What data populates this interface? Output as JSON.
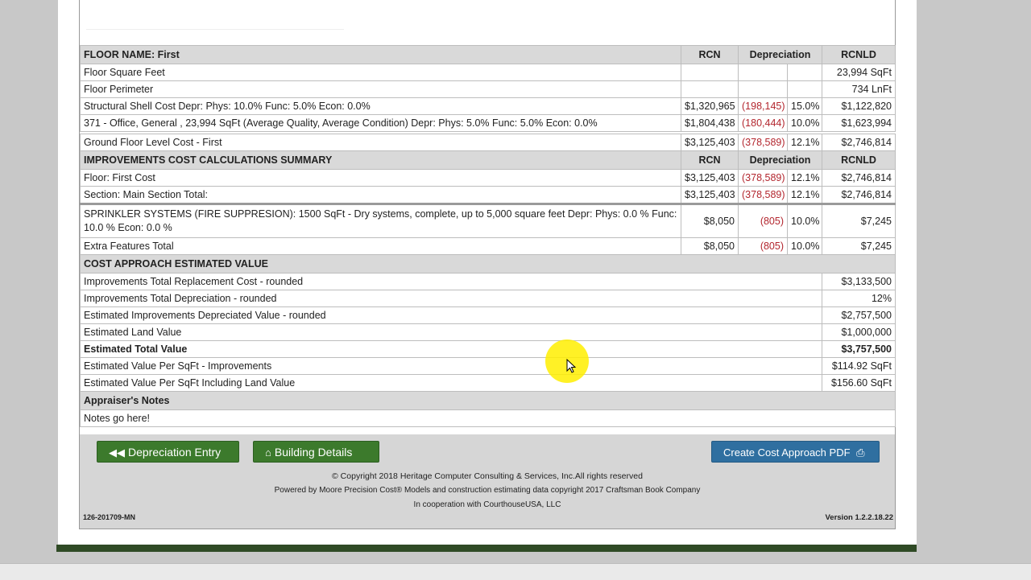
{
  "floor_section": {
    "header": {
      "label": "FLOOR NAME: First",
      "rcn": "RCN",
      "depreciation": "Depreciation",
      "rcnld": "RCNLD"
    },
    "rows": [
      {
        "label": "Floor Square Feet",
        "rcn": "",
        "dep": "",
        "pct": "",
        "rcnld": "23,994 SqFt"
      },
      {
        "label": "Floor Perimeter",
        "rcn": "",
        "dep": "",
        "pct": "",
        "rcnld": "734 LnFt"
      },
      {
        "label": "Structural Shell Cost Depr: Phys: 10.0% Func: 5.0% Econ: 0.0%",
        "rcn": "$1,320,965",
        "dep": "(198,145)",
        "pct": "15.0%",
        "rcnld": "$1,122,820"
      },
      {
        "label": "371 - Office, General , 23,994 SqFt (Average Quality, Average Condition) Depr: Phys: 5.0% Func: 5.0% Econ: 0.0%",
        "rcn": "$1,804,438",
        "dep": "(180,444)",
        "pct": "10.0%",
        "rcnld": "$1,623,994"
      }
    ],
    "ground": {
      "label": "Ground Floor Level Cost - First",
      "rcn": "$3,125,403",
      "dep": "(378,589)",
      "pct": "12.1%",
      "rcnld": "$2,746,814"
    }
  },
  "summary_section": {
    "header": {
      "label": "IMPROVEMENTS COST CALCULATIONS SUMMARY",
      "rcn": "RCN",
      "depreciation": "Depreciation",
      "rcnld": "RCNLD"
    },
    "rows": [
      {
        "label": "Floor: First Cost",
        "rcn": "$3,125,403",
        "dep": "(378,589)",
        "pct": "12.1%",
        "rcnld": "$2,746,814"
      },
      {
        "label": "Section: Main Section Total:",
        "rcn": "$3,125,403",
        "dep": "(378,589)",
        "pct": "12.1%",
        "rcnld": "$2,746,814"
      }
    ],
    "sprinkler": {
      "label": "SPRINKLER SYSTEMS (FIRE SUPPRESION): 1500 SqFt - Dry systems, complete, up to 5,000 square feet Depr: Phys: 0.0 % Func: 10.0 % Econ: 0.0 %",
      "rcn": "$8,050",
      "dep": "(805)",
      "pct": "10.0%",
      "rcnld": "$7,245"
    },
    "extra": {
      "label": "Extra Features Total",
      "rcn": "$8,050",
      "dep": "(805)",
      "pct": "10.0%",
      "rcnld": "$7,245"
    }
  },
  "cost_approach": {
    "header": "COST APPROACH ESTIMATED VALUE",
    "rows": [
      {
        "label": "Improvements Total Replacement Cost - rounded",
        "value": "$3,133,500"
      },
      {
        "label": "Improvements Total Depreciation - rounded",
        "value": "12%"
      },
      {
        "label": "Estimated Improvements Depreciated Value - rounded",
        "value": "$2,757,500"
      },
      {
        "label": "Estimated Land Value",
        "value": "$1,000,000"
      },
      {
        "label": "Estimated Total Value",
        "value": "$3,757,500"
      },
      {
        "label": "Estimated Value Per SqFt - Improvements",
        "value": "$114.92 SqFt"
      },
      {
        "label": "Estimated Value Per SqFt Including Land Value",
        "value": "$156.60 SqFt"
      }
    ]
  },
  "notes": {
    "header": "Appraiser's Notes",
    "text": "Notes go here!"
  },
  "buttons": {
    "depreciation_entry": "Depreciation Entry",
    "building_details": "Building Details",
    "create_pdf": "Create Cost Approach PDF"
  },
  "footer": {
    "copyright": "© Copyright 2018 Heritage Computer Consulting & Services, Inc.All rights reserved",
    "powered": "Powered by Moore Precision Cost® Models and construction estimating data copyright 2017 Craftsman Book Company",
    "cooperation": "In cooperation with CourthouseUSA, LLC",
    "id": "126-201709-MN",
    "version": "Version 1.2.2.18.22"
  },
  "icons": {
    "back": "double-left-arrow-icon",
    "home": "home-icon",
    "print": "printer-icon"
  },
  "colors": {
    "header_bg": "#d9d9d9",
    "negative": "#b3262e",
    "button_green": "#3c7a2c",
    "button_blue": "#2f6fa0",
    "footer_bar": "#2f4a25"
  }
}
